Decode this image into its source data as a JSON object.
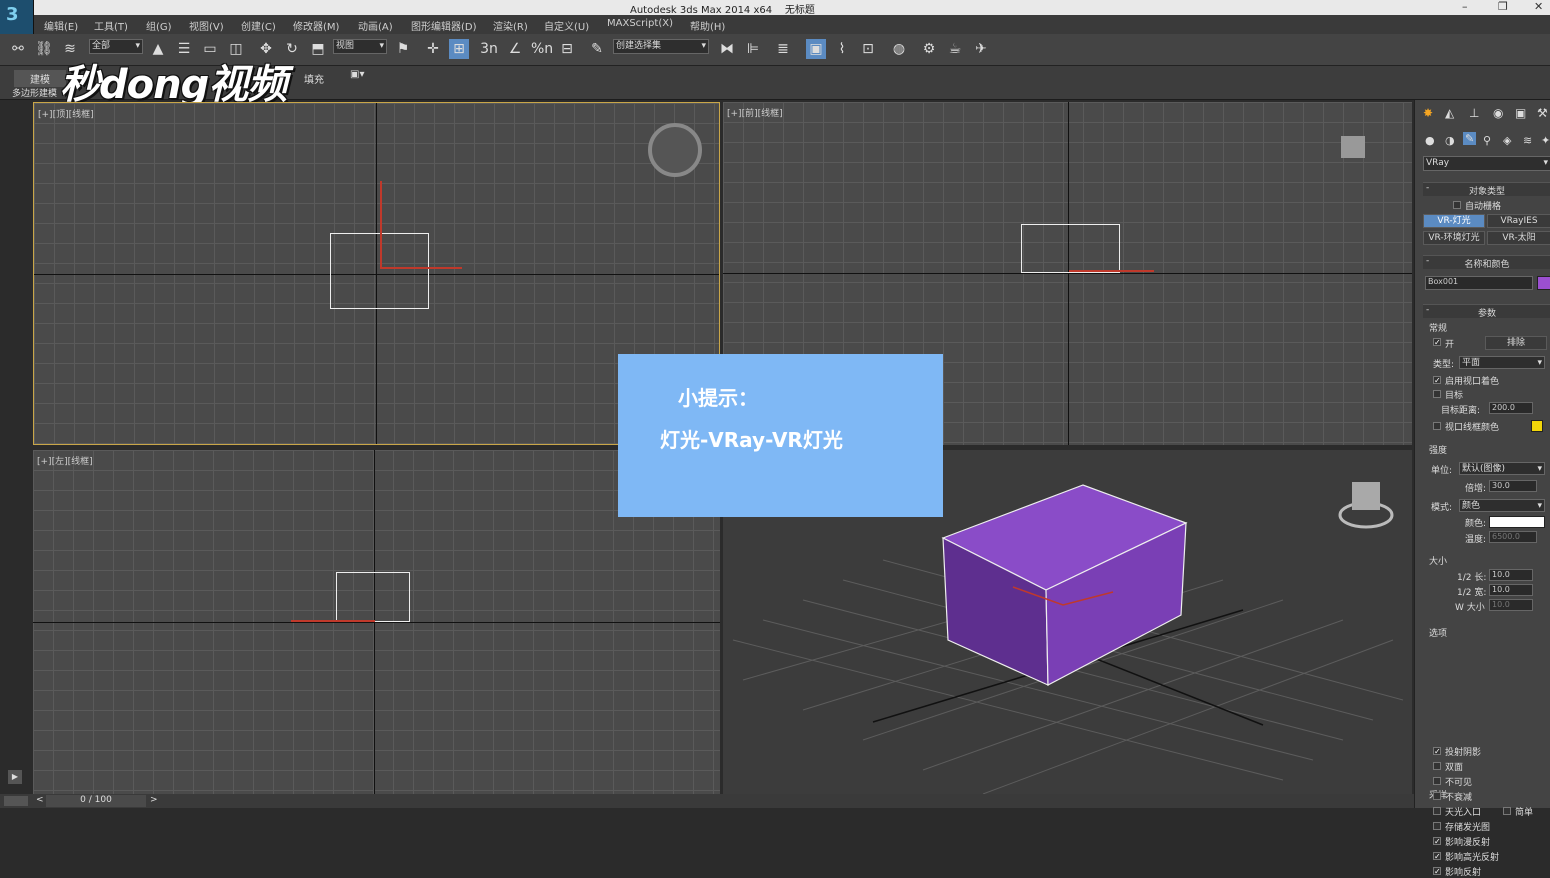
{
  "window": {
    "title": "Autodesk 3ds Max  2014 x64",
    "doc": "无标题",
    "minimize": "–",
    "restore": "❐",
    "close": "✕"
  },
  "app_icon": "3",
  "menu": [
    "编辑(E)",
    "工具(T)",
    "组(G)",
    "视图(V)",
    "创建(C)",
    "修改器(M)",
    "动画(A)",
    "图形编辑器(D)",
    "渲染(R)",
    "自定义(U)",
    "MAXScript(X)",
    "帮助(H)"
  ],
  "toolbar": {
    "filter_select": "全部",
    "coord_select": "视图",
    "named_set": "创建选择集",
    "snap_labels": [
      "3n",
      "%n"
    ]
  },
  "ribbon": {
    "tab_model": "建模",
    "tab_fill": "填充",
    "poly_label": "多边形建模"
  },
  "watermark": "秒dong视频",
  "viewports": {
    "top": "[+][顶][线框]",
    "front": "[+][前][线框]",
    "left": "[+][左][线框]"
  },
  "tip": {
    "line1": "小提示：",
    "line2": "灯光-VRay-VR灯光"
  },
  "panel": {
    "renderer_select": "VRay",
    "object_type": {
      "title": "对象类型",
      "autogrid": "自动栅格",
      "btn1": "VR-灯光",
      "btn2": "VRayIES",
      "btn3": "VR-环境灯光",
      "btn4": "VR-太阳"
    },
    "name_color": {
      "title": "名称和颜色",
      "name": "Box001",
      "color": "#9b4fd1"
    },
    "params": {
      "title": "参数",
      "general": "常规",
      "on": "开",
      "exclude": "排除",
      "type_label": "类型:",
      "type_value": "平面",
      "viewport_shade": "启用视口着色",
      "target": "目标",
      "target_dist_label": "目标距离:",
      "target_dist": "200.0",
      "viewport_wire": "视口线框颜色",
      "wire_color": "#f2d60a",
      "intensity": "强度",
      "unit_label": "单位:",
      "unit_value": "默认(图像)",
      "mult_label": "倍增:",
      "mult_value": "30.0",
      "mode_label": "模式:",
      "mode_value": "颜色",
      "color_label": "颜色:",
      "color_value": "#ffffff",
      "temp_label": "温度:",
      "temp_value": "6500.0",
      "size": "大小",
      "half_len_label": "1/2 长:",
      "half_len": "10.0",
      "half_wid_label": "1/2 宽:",
      "half_wid": "10.0",
      "w_size_label": "W 大小",
      "w_size": "10.0",
      "options": "选项",
      "opt_items": [
        "投射阴影",
        "双面",
        "不可见",
        "不衰减",
        "天光入口",
        "存储发光图",
        "影响漫反射",
        "影响高光反射",
        "影响反射"
      ],
      "opt_checked": [
        true,
        false,
        false,
        false,
        false,
        false,
        true,
        true,
        true
      ],
      "simple": "简单",
      "sampling": "采样"
    }
  },
  "timeline": {
    "frame": "0 / 100"
  }
}
